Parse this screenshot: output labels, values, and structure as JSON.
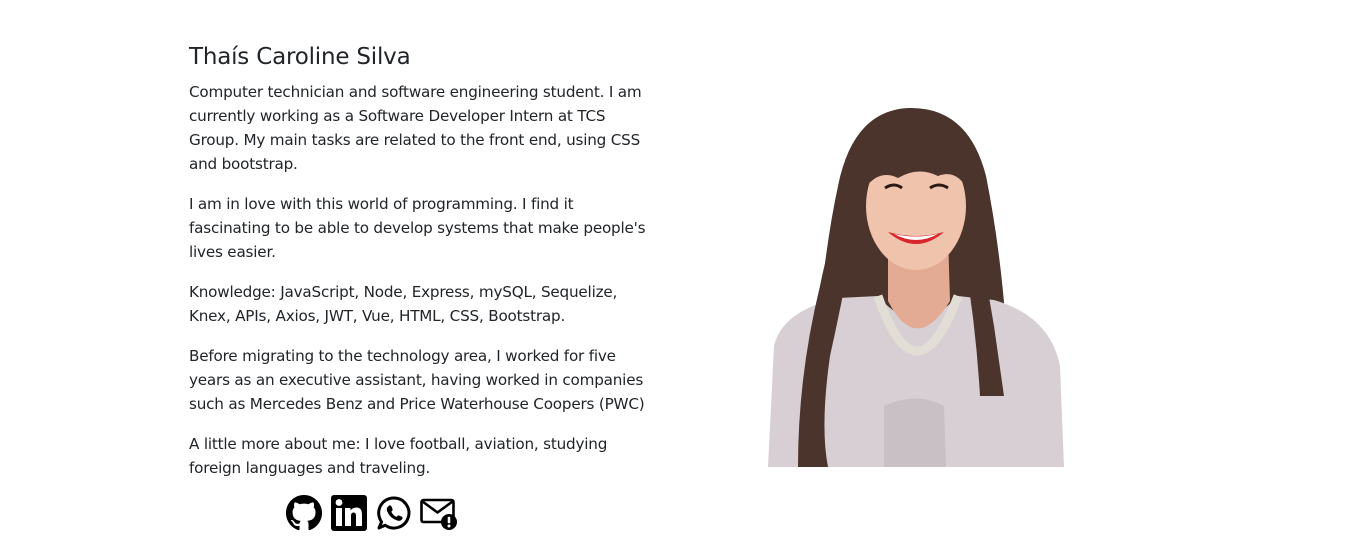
{
  "profile": {
    "name": "Thaís Caroline Silva",
    "paragraphs": [
      "Computer technician and software engineering student. I am currently working as a Software Developer Intern at TCS Group. My main tasks are related to the front end, using CSS and bootstrap.",
      "I am in love with this world of programming. I find it fascinating to be able to develop systems that make people's lives easier.",
      "Knowledge: JavaScript, Node, Express, mySQL, Sequelize, Knex, APIs, Axios, JWT, Vue, HTML, CSS, Bootstrap.",
      "Before migrating to the technology area, I worked for five years as an executive assistant, having worked in companies such as Mercedes Benz and Price Waterhouse Coopers (PWC)",
      "A little more about me: I love football, aviation, studying foreign languages and traveling."
    ]
  },
  "photo": {
    "icon": "portrait-photo",
    "colors": {
      "hair": "#4a342c",
      "skin": "#f0c3ad",
      "shirt": "#d7cfd4",
      "lips": "#d9262c"
    }
  },
  "socials": [
    {
      "icon": "github-icon"
    },
    {
      "icon": "linkedin-icon"
    },
    {
      "icon": "whatsapp-icon"
    },
    {
      "icon": "email-icon"
    }
  ]
}
